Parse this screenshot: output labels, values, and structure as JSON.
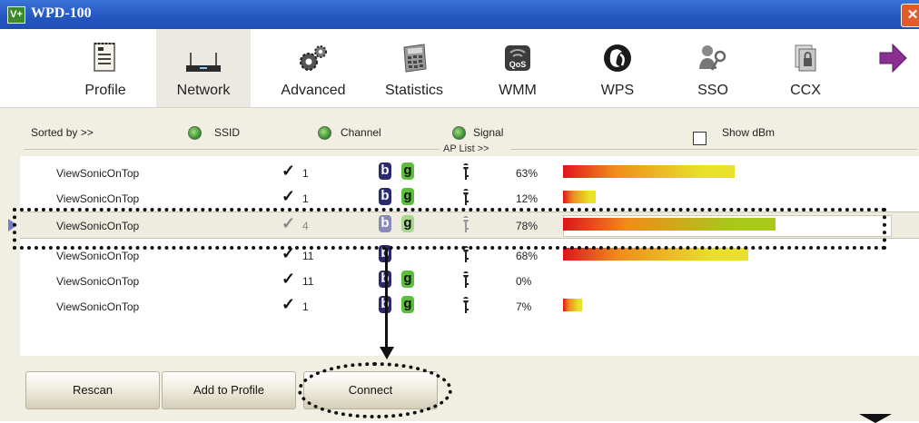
{
  "window": {
    "title": "WPD-100",
    "logo_text": "V+",
    "close_glyph": "✕"
  },
  "toolbar": {
    "items": [
      {
        "label": "Profile",
        "icon": "profile-icon"
      },
      {
        "label": "Network",
        "icon": "network-icon",
        "active": true
      },
      {
        "label": "Advanced",
        "icon": "advanced-icon"
      },
      {
        "label": "Statistics",
        "icon": "statistics-icon"
      },
      {
        "label": "WMM",
        "icon": "wmm-icon",
        "icon_text": "QoS"
      },
      {
        "label": "WPS",
        "icon": "wps-icon"
      },
      {
        "label": "SSO",
        "icon": "sso-icon"
      },
      {
        "label": "CCX",
        "icon": "ccx-icon"
      }
    ],
    "more_icon": "arrow-right-icon"
  },
  "sort": {
    "sorted_by": "Sorted by >>",
    "ssid": "SSID",
    "channel": "Channel",
    "signal": "Signal",
    "show_dbm": "Show dBm",
    "ap_list": "AP List >>"
  },
  "ap_list": [
    {
      "ssid": "ViewSonicOnTop",
      "channel": "1",
      "b": "b",
      "g": "g",
      "signal": "63%",
      "signal_value": 0.63
    },
    {
      "ssid": "ViewSonicOnTop",
      "channel": "1",
      "b": "b",
      "g": "g",
      "signal": "12%",
      "signal_value": 0.12
    },
    {
      "ssid": "ViewSonicOnTop",
      "channel": "4",
      "b": "b",
      "g": "g",
      "signal": "78%",
      "signal_value": 0.78,
      "selected": true
    },
    {
      "ssid": "ViewSonicOnTop",
      "channel": "11",
      "b": "b",
      "g": "",
      "signal": "68%",
      "signal_value": 0.68
    },
    {
      "ssid": "ViewSonicOnTop",
      "channel": "11",
      "b": "b",
      "g": "g",
      "signal": "0%",
      "signal_value": 0.0
    },
    {
      "ssid": "ViewSonicOnTop",
      "channel": "1",
      "b": "b",
      "g": "g",
      "signal": "7%",
      "signal_value": 0.07
    }
  ],
  "buttons": {
    "rescan": "Rescan",
    "add_to_profile": "Add to Profile",
    "connect": "Connect"
  },
  "colors": {
    "bar_start": "#e0141a",
    "bar_mid": "#f08c1c",
    "bar_end": "#e8e02a",
    "bar_end_green": "#a8c81e",
    "title_blue": "#2456c0"
  }
}
